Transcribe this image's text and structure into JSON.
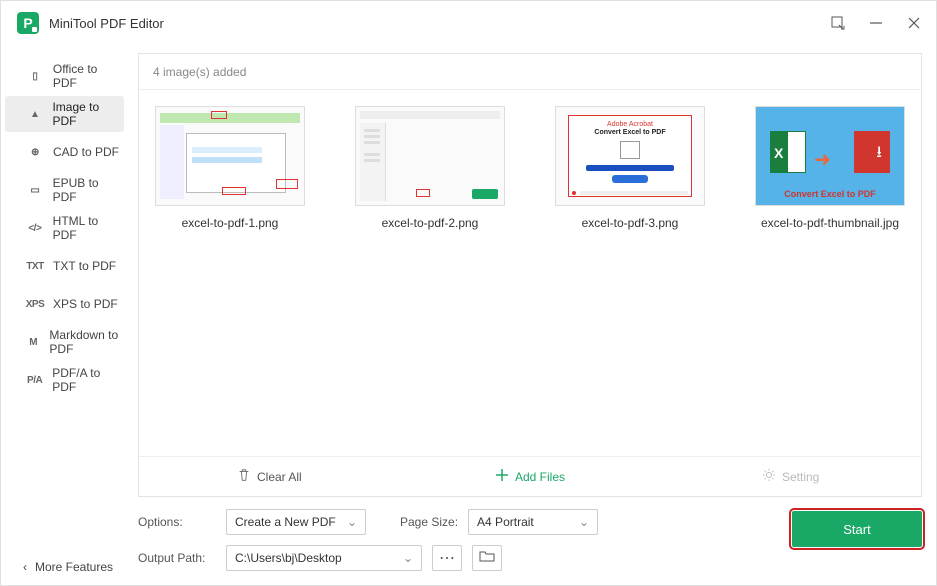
{
  "app": {
    "title": "MiniTool PDF Editor"
  },
  "sidebar": {
    "items": [
      {
        "icon": "▯",
        "label": "Office to PDF"
      },
      {
        "icon": "▲",
        "label": "Image to PDF"
      },
      {
        "icon": "⊕",
        "label": "CAD to PDF"
      },
      {
        "icon": "▭",
        "label": "EPUB to PDF"
      },
      {
        "icon": "</>",
        "label": "HTML to PDF"
      },
      {
        "icon": "TXT",
        "label": "TXT to PDF"
      },
      {
        "icon": "XPS",
        "label": "XPS to PDF"
      },
      {
        "icon": "M",
        "label": "Markdown to PDF"
      },
      {
        "icon": "P/A",
        "label": "PDF/A to PDF"
      }
    ],
    "more": "More Features"
  },
  "panel": {
    "header": "4 image(s) added",
    "files": [
      "excel-to-pdf-1.png",
      "excel-to-pdf-2.png",
      "excel-to-pdf-3.png",
      "excel-to-pdf-thumbnail.jpg"
    ],
    "thumbs": {
      "t3_brand": "Adobe Acrobat",
      "t3_title": "Convert Excel to PDF",
      "t4_caption": "Convert Excel to PDF"
    },
    "toolbar": {
      "clear": "Clear All",
      "add": "Add Files",
      "setting": "Setting"
    }
  },
  "bottom": {
    "options_label": "Options:",
    "options_value": "Create a New PDF",
    "pagesize_label": "Page Size:",
    "pagesize_value": "A4 Portrait",
    "output_label": "Output Path:",
    "output_value": "C:\\Users\\bj\\Desktop",
    "start": "Start"
  }
}
